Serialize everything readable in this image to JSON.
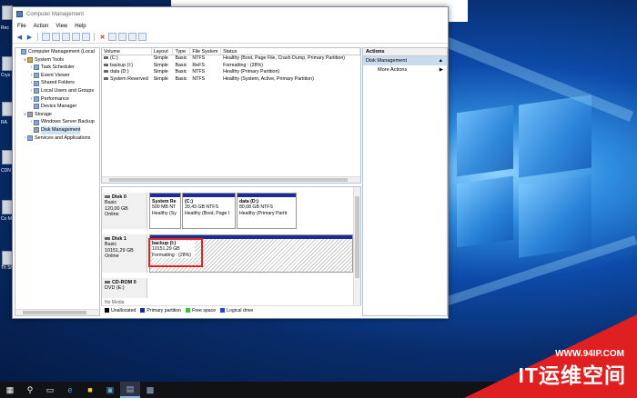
{
  "window": {
    "title": "Computer Management"
  },
  "menu": [
    "File",
    "Action",
    "View",
    "Help"
  ],
  "tree": {
    "items": [
      {
        "label": "Computer Management (Local",
        "level": 0,
        "twisty": "",
        "icon": "computer-icon"
      },
      {
        "label": "System Tools",
        "level": 1,
        "twisty": "v",
        "icon": "toolbox-icon"
      },
      {
        "label": "Task Scheduler",
        "level": 2,
        "twisty": ">",
        "icon": "clock-icon"
      },
      {
        "label": "Event Viewer",
        "level": 2,
        "twisty": ">",
        "icon": "event-icon"
      },
      {
        "label": "Shared Folders",
        "level": 2,
        "twisty": ">",
        "icon": "folder-icon"
      },
      {
        "label": "Local Users and Groups",
        "level": 2,
        "twisty": ">",
        "icon": "users-icon"
      },
      {
        "label": "Performance",
        "level": 2,
        "twisty": ">",
        "icon": "gauge-icon"
      },
      {
        "label": "Device Manager",
        "level": 2,
        "twisty": "",
        "icon": "device-icon"
      },
      {
        "label": "Storage",
        "level": 1,
        "twisty": "v",
        "icon": "storage-icon"
      },
      {
        "label": "Windows Server Backup",
        "level": 2,
        "twisty": ">",
        "icon": "backup-icon"
      },
      {
        "label": "Disk Management",
        "level": 2,
        "twisty": "",
        "icon": "disk-icon",
        "selected": true
      },
      {
        "label": "Services and Applications",
        "level": 1,
        "twisty": ">",
        "icon": "services-icon"
      }
    ]
  },
  "volumes": {
    "headers": [
      "Volume",
      "Layout",
      "Type",
      "File System",
      "Status"
    ],
    "rows": [
      [
        "(C:)",
        "Simple",
        "Basic",
        "NTFS",
        "Healthy (Boot, Page File, Crash Dump, Primary Partition)"
      ],
      [
        "backup (I:)",
        "Simple",
        "Basic",
        "ReFS",
        "Formatting : (28%)"
      ],
      [
        "data (D:)",
        "Simple",
        "Basic",
        "NTFS",
        "Healthy (Primary Partition)"
      ],
      [
        "System Reserved",
        "Simple",
        "Basic",
        "NTFS",
        "Healthy (System, Active, Primary Partition)"
      ]
    ]
  },
  "disks": {
    "disk0": {
      "name": "Disk 0",
      "type": "Basic",
      "size": "120,00 GB",
      "state": "Online",
      "parts": [
        {
          "l1": "System Re",
          "l2": "500 MB NT",
          "l3": "Healthy (Sy"
        },
        {
          "l1": "(C:)",
          "l2": "39,43 GB NTFS",
          "l3": "Healthy (Boot, Page I"
        },
        {
          "l1": "data  (D:)",
          "l2": "80,08 GB NTFS",
          "l3": "Healthy (Primary Partit"
        }
      ]
    },
    "disk1": {
      "name": "Disk 1",
      "type": "Basic",
      "size": "10151,29 GB",
      "state": "Online",
      "parts": [
        {
          "l1": "backup  (I:)",
          "l2": "10151,29 GB",
          "l3": "Formatting : (28%)"
        }
      ]
    },
    "cdrom0": {
      "name": "CD-ROM 0",
      "type": "DVD (E:)"
    },
    "cut": "No Media"
  },
  "legend": [
    {
      "label": "Unallocated",
      "color": "#000000"
    },
    {
      "label": "Primary partition",
      "color": "#1c2b9a"
    },
    {
      "label": "Free space",
      "color": "#3fbf3f"
    },
    {
      "label": "Logical drive",
      "color": "#2a3fd6"
    }
  ],
  "actions": {
    "header": "Actions",
    "section": "Disk Management",
    "item": "More Actions"
  },
  "desktop": {
    "labels": [
      "Rec",
      "Crys",
      "RA",
      "CDN",
      "Co M",
      "Th Sh"
    ]
  },
  "watermark": {
    "url": "WWW.94IP.COM",
    "brand": "IT运维空间"
  }
}
